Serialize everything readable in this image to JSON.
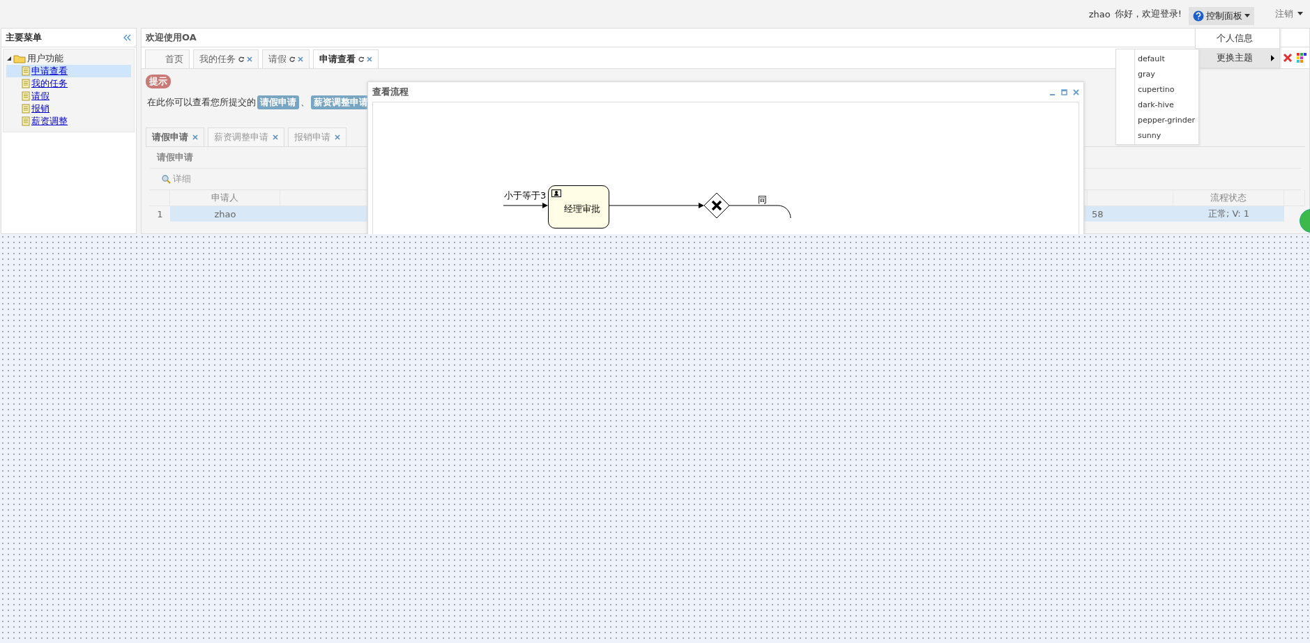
{
  "top_bar": {
    "user": "zhao",
    "greeting": "你好，欢迎登录!",
    "control_panel": "控制面板",
    "logout": "注销"
  },
  "control_menu": {
    "items": [
      {
        "label": "个人信息",
        "selected": false,
        "submenu": false
      },
      {
        "label": "更换主题",
        "selected": true,
        "submenu": true
      }
    ]
  },
  "theme_menu": {
    "items": [
      "default",
      "gray",
      "cupertino",
      "dark-hive",
      "pepper-grinder",
      "sunny"
    ]
  },
  "sidebar": {
    "title": "主要菜单",
    "tree": [
      {
        "label": "用户功能",
        "expanded": true,
        "children": [
          {
            "label": "申请查看",
            "selected": true
          },
          {
            "label": "我的任务",
            "selected": false
          },
          {
            "label": "请假",
            "selected": false
          },
          {
            "label": "报销",
            "selected": false
          },
          {
            "label": "薪资调整",
            "selected": false
          }
        ]
      }
    ]
  },
  "main": {
    "title": "欢迎使用OA",
    "tabs": [
      {
        "label": "首页",
        "selected": false,
        "closable": false
      },
      {
        "label": "我的任务",
        "selected": false,
        "closable": true
      },
      {
        "label": "请假",
        "selected": false,
        "closable": true
      },
      {
        "label": "申请查看",
        "selected": true,
        "closable": true
      }
    ]
  },
  "tip": {
    "badge": "提示",
    "segments": [
      {
        "kind": "text",
        "text": "在此你可以查看您所提交的"
      },
      {
        "kind": "tag",
        "text": "请假申请"
      },
      {
        "kind": "text",
        "text": "、"
      },
      {
        "kind": "tag",
        "text": "薪资调整申请"
      }
    ]
  },
  "sub_tabs": [
    {
      "label": "请假申请",
      "selected": true
    },
    {
      "label": "薪资调整申请",
      "selected": false
    },
    {
      "label": "报销申请",
      "selected": false
    }
  ],
  "panel": {
    "title": "请假申请",
    "toolbar": [
      {
        "label": "详细"
      }
    ]
  },
  "table": {
    "columns": [
      {
        "heading": "申请人"
      },
      {},
      {},
      {
        "heading": "流程状态"
      }
    ],
    "rows": [
      {
        "number": "1",
        "selected": true,
        "cells": [
          "zhao",
          "",
          "58",
          "正常; V: 1"
        ]
      }
    ]
  },
  "dialog": {
    "title": "查看流程",
    "diagram": {
      "condition": "小于等于3",
      "task": "经理审批",
      "flow_label": "同"
    }
  }
}
